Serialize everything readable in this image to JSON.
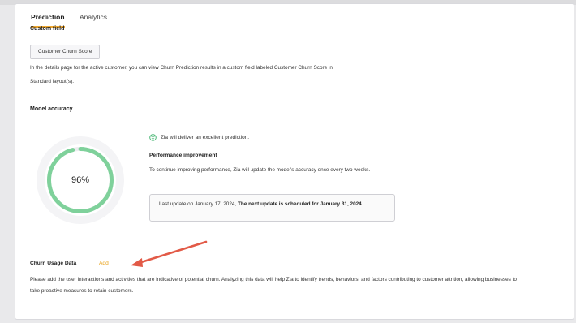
{
  "tabs": [
    {
      "label": "Prediction",
      "active": true
    },
    {
      "label": "Analytics",
      "active": false
    }
  ],
  "custom_field": {
    "title": "Custom field",
    "button_label": "Customer Churn Score",
    "description_line1": "In the details page for the active customer, you can view Churn Prediction results in a custom field labeled Customer Churn Score in",
    "description_line2": "Standard layout(s)."
  },
  "model_accuracy": {
    "title": "Model accuracy",
    "percent_label": "96%",
    "percent_value": 96,
    "ring_color": "#7fd19b",
    "zia_message": "Zia will deliver an excellent prediction.",
    "perf_title": "Performance improvement",
    "perf_desc": "To continue improving performance, Zia will update the model's accuracy once every two weeks.",
    "last_update": "Last update on January 17, 2024,",
    "next_update": "The next update is scheduled for January 31, 2024."
  },
  "churn_usage": {
    "title": "Churn Usage Data",
    "add_label": "Add",
    "add_color": "#e8a21b",
    "description": "Please add the user interactions and activities that are indicative of potential churn. Analyzing this data will help Zia to identify trends, behaviors, and factors contributing to customer attrition, allowing businesses to take proactive measures to retain customers."
  },
  "annotation": {
    "arrow_color": "#e25a47"
  }
}
